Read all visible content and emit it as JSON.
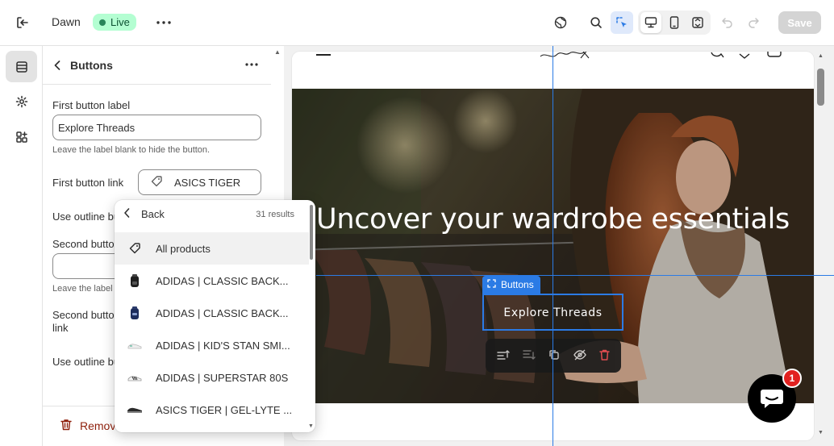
{
  "topbar": {
    "theme_name": "Dawn",
    "status": "Live",
    "save_label": "Save"
  },
  "panel": {
    "title": "Buttons",
    "first_label_label": "First button label",
    "first_label_value": "Explore Threads",
    "first_label_help": "Leave the label blank to hide the button.",
    "first_link_label": "First button link",
    "first_link_value": "ASICS TIGER",
    "outline_1_label": "Use outline bu",
    "second_label_label": "Second butto",
    "second_label_value": "",
    "second_label_help": "Leave the label",
    "second_link_label_1": "Second butto",
    "second_link_label_2": "link",
    "outline_2_label": "Use outline bu",
    "remove_label": "Remov"
  },
  "popover": {
    "back_label": "Back",
    "results": "31 results",
    "items": [
      {
        "label": "All products",
        "icon": "tag-icon"
      },
      {
        "label": "ADIDAS | CLASSIC BACK...",
        "icon": "backpack-black-thumb"
      },
      {
        "label": "ADIDAS | CLASSIC BACK...",
        "icon": "backpack-blue-thumb"
      },
      {
        "label": "ADIDAS | KID'S STAN SMI...",
        "icon": "sneaker-white-thumb"
      },
      {
        "label": "ADIDAS | SUPERSTAR 80S",
        "icon": "sneaker-stripe-thumb"
      },
      {
        "label": "ASICS TIGER | GEL-LYTE ...",
        "icon": "sneaker-dark-thumb"
      }
    ]
  },
  "preview": {
    "logo": "fashion",
    "hero_title": "Uncover your wardrobe essentials",
    "hero_button": "Explore Threads",
    "selection_tag": "Buttons",
    "chat_badge": "1"
  },
  "colors": {
    "accent": "#2b7be5",
    "live_bg": "#b4fed2",
    "danger": "#e51c00"
  }
}
